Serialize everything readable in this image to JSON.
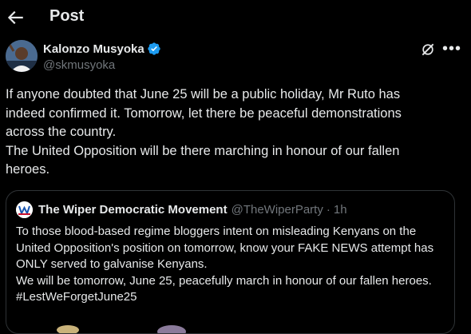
{
  "header": {
    "title": "Post"
  },
  "tweet": {
    "author_name": "Kalonzo Musyoka",
    "author_handle": "@skmusyoka",
    "lines": [
      "If anyone doubted that June 25 will be a public holiday, Mr Ruto has",
      "indeed confirmed it. Tomorrow, let there be peaceful demonstrations",
      "across the country.",
      "The United Opposition will be there marching in honour of our fallen",
      "heroes."
    ]
  },
  "quote": {
    "author_name": "The Wiper Democratic Movement",
    "author_handle": "@TheWiperParty",
    "separator": "·",
    "time": "1h",
    "lines": [
      "To those blood-based regime bloggers intent on misleading Kenyans on the",
      "United Opposition's position on tomorrow, know your FAKE NEWS attempt has",
      "ONLY served to galvanise Kenyans.",
      "We will be tomorrow, June 25, peacefully march in honour of our fallen heroes.",
      "#LestWeForgetJune25"
    ]
  },
  "colors": {
    "background": "#000000",
    "text": "#e7e9ea",
    "secondary": "#71767b",
    "verified": "#1d9bf0",
    "border": "#2f3336"
  },
  "icons": {
    "back": "arrow-left-icon",
    "verified": "verified-badge-icon",
    "grok": "grok-icon",
    "more": "more-horizontal-icon"
  }
}
